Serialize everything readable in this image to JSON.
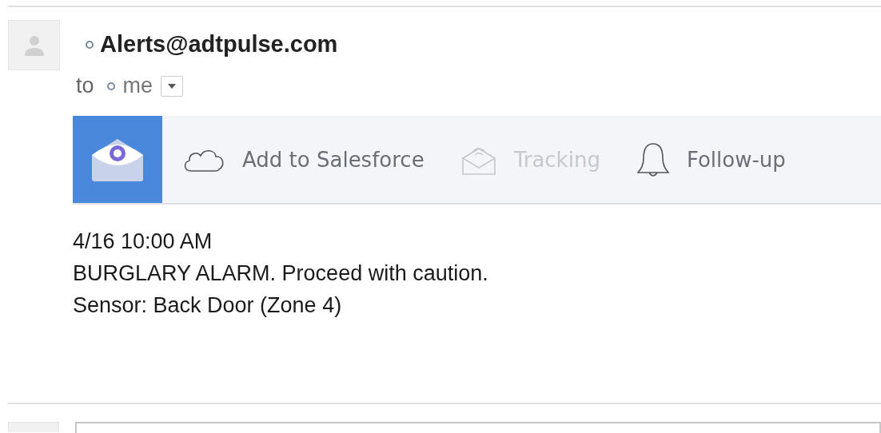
{
  "message": {
    "sender": "Alerts@adtpulse.com",
    "to_label": "to",
    "recipient": "me"
  },
  "toolbar": {
    "items": [
      {
        "kind": "cloud",
        "label": "Add to Salesforce",
        "disabled": false
      },
      {
        "kind": "tracking",
        "label": "Tracking",
        "disabled": true
      },
      {
        "kind": "bell",
        "label": "Follow-up",
        "disabled": false
      }
    ]
  },
  "body": [
    "4/16 10:00 AM",
    "BURGLARY ALARM. Proceed with caution.",
    "Sensor: Back Door (Zone 4)"
  ]
}
